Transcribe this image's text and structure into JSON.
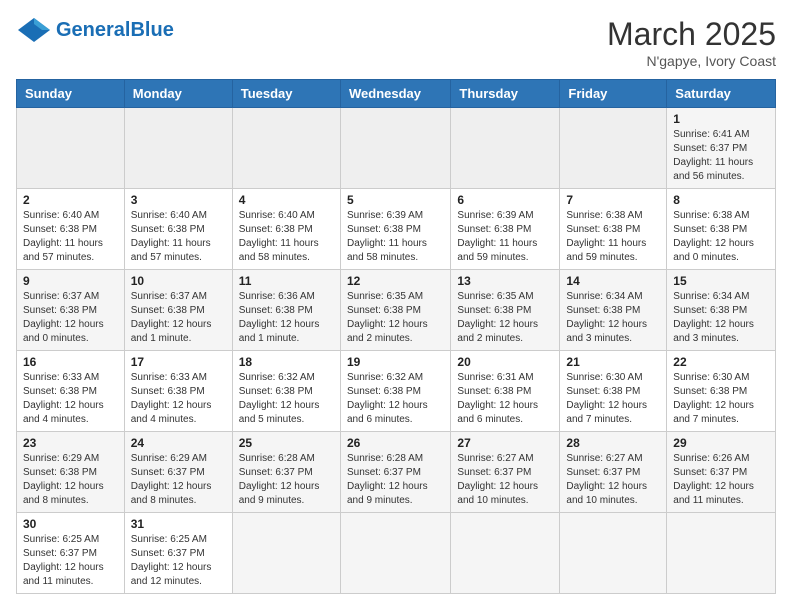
{
  "header": {
    "logo_general": "General",
    "logo_blue": "Blue",
    "month_year": "March 2025",
    "location": "N'gapye, Ivory Coast"
  },
  "weekdays": [
    "Sunday",
    "Monday",
    "Tuesday",
    "Wednesday",
    "Thursday",
    "Friday",
    "Saturday"
  ],
  "weeks": [
    [
      {
        "day": "",
        "info": ""
      },
      {
        "day": "",
        "info": ""
      },
      {
        "day": "",
        "info": ""
      },
      {
        "day": "",
        "info": ""
      },
      {
        "day": "",
        "info": ""
      },
      {
        "day": "",
        "info": ""
      },
      {
        "day": "1",
        "info": "Sunrise: 6:41 AM\nSunset: 6:37 PM\nDaylight: 11 hours\nand 56 minutes."
      }
    ],
    [
      {
        "day": "2",
        "info": "Sunrise: 6:40 AM\nSunset: 6:38 PM\nDaylight: 11 hours\nand 57 minutes."
      },
      {
        "day": "3",
        "info": "Sunrise: 6:40 AM\nSunset: 6:38 PM\nDaylight: 11 hours\nand 57 minutes."
      },
      {
        "day": "4",
        "info": "Sunrise: 6:40 AM\nSunset: 6:38 PM\nDaylight: 11 hours\nand 58 minutes."
      },
      {
        "day": "5",
        "info": "Sunrise: 6:39 AM\nSunset: 6:38 PM\nDaylight: 11 hours\nand 58 minutes."
      },
      {
        "day": "6",
        "info": "Sunrise: 6:39 AM\nSunset: 6:38 PM\nDaylight: 11 hours\nand 59 minutes."
      },
      {
        "day": "7",
        "info": "Sunrise: 6:38 AM\nSunset: 6:38 PM\nDaylight: 11 hours\nand 59 minutes."
      },
      {
        "day": "8",
        "info": "Sunrise: 6:38 AM\nSunset: 6:38 PM\nDaylight: 12 hours\nand 0 minutes."
      }
    ],
    [
      {
        "day": "9",
        "info": "Sunrise: 6:37 AM\nSunset: 6:38 PM\nDaylight: 12 hours\nand 0 minutes."
      },
      {
        "day": "10",
        "info": "Sunrise: 6:37 AM\nSunset: 6:38 PM\nDaylight: 12 hours\nand 1 minute."
      },
      {
        "day": "11",
        "info": "Sunrise: 6:36 AM\nSunset: 6:38 PM\nDaylight: 12 hours\nand 1 minute."
      },
      {
        "day": "12",
        "info": "Sunrise: 6:35 AM\nSunset: 6:38 PM\nDaylight: 12 hours\nand 2 minutes."
      },
      {
        "day": "13",
        "info": "Sunrise: 6:35 AM\nSunset: 6:38 PM\nDaylight: 12 hours\nand 2 minutes."
      },
      {
        "day": "14",
        "info": "Sunrise: 6:34 AM\nSunset: 6:38 PM\nDaylight: 12 hours\nand 3 minutes."
      },
      {
        "day": "15",
        "info": "Sunrise: 6:34 AM\nSunset: 6:38 PM\nDaylight: 12 hours\nand 3 minutes."
      }
    ],
    [
      {
        "day": "16",
        "info": "Sunrise: 6:33 AM\nSunset: 6:38 PM\nDaylight: 12 hours\nand 4 minutes."
      },
      {
        "day": "17",
        "info": "Sunrise: 6:33 AM\nSunset: 6:38 PM\nDaylight: 12 hours\nand 4 minutes."
      },
      {
        "day": "18",
        "info": "Sunrise: 6:32 AM\nSunset: 6:38 PM\nDaylight: 12 hours\nand 5 minutes."
      },
      {
        "day": "19",
        "info": "Sunrise: 6:32 AM\nSunset: 6:38 PM\nDaylight: 12 hours\nand 6 minutes."
      },
      {
        "day": "20",
        "info": "Sunrise: 6:31 AM\nSunset: 6:38 PM\nDaylight: 12 hours\nand 6 minutes."
      },
      {
        "day": "21",
        "info": "Sunrise: 6:30 AM\nSunset: 6:38 PM\nDaylight: 12 hours\nand 7 minutes."
      },
      {
        "day": "22",
        "info": "Sunrise: 6:30 AM\nSunset: 6:38 PM\nDaylight: 12 hours\nand 7 minutes."
      }
    ],
    [
      {
        "day": "23",
        "info": "Sunrise: 6:29 AM\nSunset: 6:38 PM\nDaylight: 12 hours\nand 8 minutes."
      },
      {
        "day": "24",
        "info": "Sunrise: 6:29 AM\nSunset: 6:37 PM\nDaylight: 12 hours\nand 8 minutes."
      },
      {
        "day": "25",
        "info": "Sunrise: 6:28 AM\nSunset: 6:37 PM\nDaylight: 12 hours\nand 9 minutes."
      },
      {
        "day": "26",
        "info": "Sunrise: 6:28 AM\nSunset: 6:37 PM\nDaylight: 12 hours\nand 9 minutes."
      },
      {
        "day": "27",
        "info": "Sunrise: 6:27 AM\nSunset: 6:37 PM\nDaylight: 12 hours\nand 10 minutes."
      },
      {
        "day": "28",
        "info": "Sunrise: 6:27 AM\nSunset: 6:37 PM\nDaylight: 12 hours\nand 10 minutes."
      },
      {
        "day": "29",
        "info": "Sunrise: 6:26 AM\nSunset: 6:37 PM\nDaylight: 12 hours\nand 11 minutes."
      }
    ],
    [
      {
        "day": "30",
        "info": "Sunrise: 6:25 AM\nSunset: 6:37 PM\nDaylight: 12 hours\nand 11 minutes."
      },
      {
        "day": "31",
        "info": "Sunrise: 6:25 AM\nSunset: 6:37 PM\nDaylight: 12 hours\nand 12 minutes."
      },
      {
        "day": "",
        "info": ""
      },
      {
        "day": "",
        "info": ""
      },
      {
        "day": "",
        "info": ""
      },
      {
        "day": "",
        "info": ""
      },
      {
        "day": "",
        "info": ""
      }
    ]
  ]
}
